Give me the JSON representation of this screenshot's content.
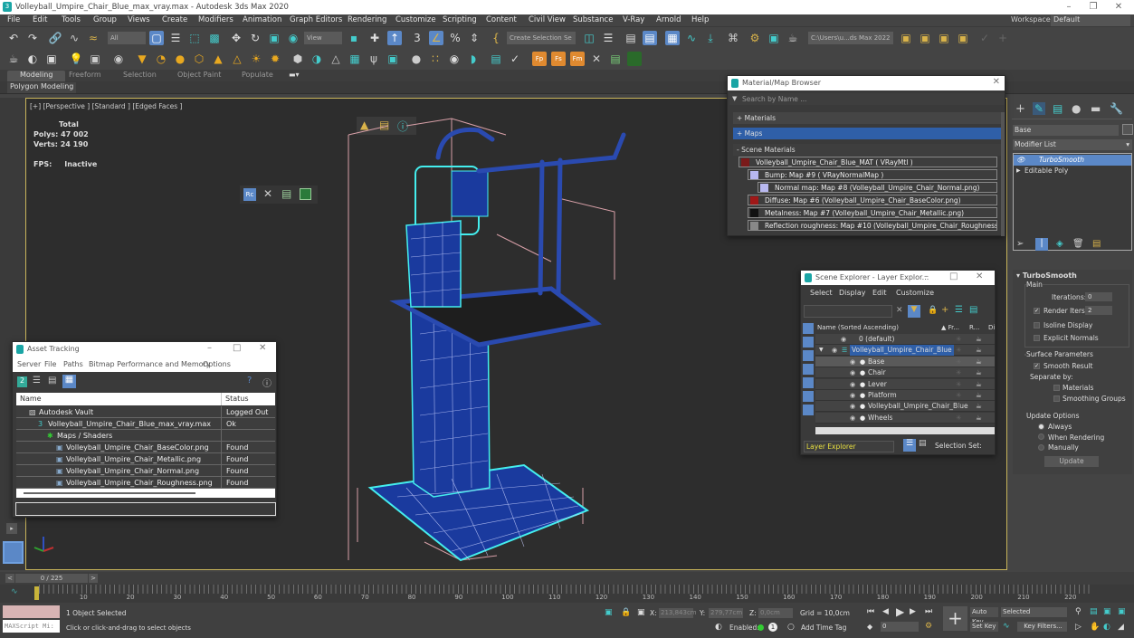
{
  "window": {
    "title": "Volleyball_Umpire_Chair_Blue_max_vray.max - Autodesk 3ds Max 2020",
    "workspaces_label": "Workspaces:",
    "workspace_value": "Default"
  },
  "menu": [
    "File",
    "Edit",
    "Tools",
    "Group",
    "Views",
    "Create",
    "Modifiers",
    "Animation",
    "Graph Editors",
    "Rendering",
    "Customize",
    "Scripting",
    "Content",
    "Civil View",
    "Substance",
    "V-Ray",
    "Arnold",
    "Help"
  ],
  "toolbar": {
    "selection_filter": "All",
    "ref_coord": "View",
    "named_selection": "Create Selection Se",
    "project_path": "C:\\Users\\u...ds Max 2022"
  },
  "ribbon": {
    "tabs": [
      "Modeling",
      "Freeform",
      "Selection",
      "Object Paint",
      "Populate"
    ],
    "active_tab": "Modeling",
    "panel": "Polygon Modeling"
  },
  "viewport": {
    "label": "[+] [Perspective ] [Standard ] [Edged Faces ]",
    "stats_total": "Total",
    "polys_label": "Polys:",
    "polys_value": "47 002",
    "verts_label": "Verts:",
    "verts_value": "24 190",
    "fps_label": "FPS:",
    "fps_value": "Inactive"
  },
  "material_browser": {
    "title": "Material/Map Browser",
    "search_placeholder": "Search by Name ...",
    "sections": [
      "+ Materials",
      "+ Maps",
      "- Scene Materials"
    ],
    "tree": [
      {
        "label": "Volleyball_Umpire_Chair_Blue_MAT ( VRayMtl )",
        "swatch": "#7a1a1a"
      },
      {
        "label": "Bump: Map #9  ( VRayNormalMap )",
        "swatch": "#b8b8f0"
      },
      {
        "label": "Normal map: Map #8 (Volleyball_Umpire_Chair_Normal.png)",
        "swatch": "#b8b8f0"
      },
      {
        "label": "Diffuse: Map #6 (Volleyball_Umpire_Chair_BaseColor.png)",
        "swatch": "#a01818"
      },
      {
        "label": "Metalness: Map #7 (Volleyball_Umpire_Chair_Metallic.png)",
        "swatch": "#111111"
      },
      {
        "label": "Reflection roughness: Map #10 (Volleyball_Umpire_Chair_Roughness.png)",
        "swatch": "#888888"
      }
    ]
  },
  "scene_explorer": {
    "title": "Scene Explorer - Layer Explor...",
    "menu": [
      "Select",
      "Display",
      "Edit",
      "Customize"
    ],
    "columns": [
      "Name (Sorted Ascending)",
      "▲ Fr...",
      "R...",
      "Di"
    ],
    "rows": [
      {
        "name": "0 (default)",
        "level": 1
      },
      {
        "name": "Volleyball_Umpire_Chair_Blue",
        "level": 0,
        "highlight": true
      },
      {
        "name": "Base",
        "level": 2,
        "selected": true
      },
      {
        "name": "Chair",
        "level": 2
      },
      {
        "name": "Lever",
        "level": 2
      },
      {
        "name": "Platform",
        "level": 2
      },
      {
        "name": "Volleyball_Umpire_Chair_Blue",
        "level": 2
      },
      {
        "name": "Wheels",
        "level": 2
      }
    ],
    "explorer_type": "Layer Explorer",
    "selection_set_label": "Selection Set:"
  },
  "asset_tracking": {
    "title": "Asset Tracking",
    "menu": [
      "Server",
      "File",
      "Paths",
      "Bitmap Performance and Memory",
      "Options"
    ],
    "columns": [
      "Name",
      "Status"
    ],
    "rows": [
      {
        "name": "Autodesk Vault",
        "status": "Logged Out ...",
        "indent": 1
      },
      {
        "name": "Volleyball_Umpire_Chair_Blue_max_vray.max",
        "status": "Ok",
        "indent": 2
      },
      {
        "name": "Maps / Shaders",
        "status": "",
        "indent": 3
      },
      {
        "name": "Volleyball_Umpire_Chair_BaseColor.png",
        "status": "Found",
        "indent": 4
      },
      {
        "name": "Volleyball_Umpire_Chair_Metallic.png",
        "status": "Found",
        "indent": 4
      },
      {
        "name": "Volleyball_Umpire_Chair_Normal.png",
        "status": "Found",
        "indent": 4
      },
      {
        "name": "Volleyball_Umpire_Chair_Roughness.png",
        "status": "Found",
        "indent": 4
      }
    ]
  },
  "command_panel": {
    "object_name": "Base",
    "modifier_list": "Modifier List",
    "stack": [
      "TurboSmooth",
      "Editable Poly"
    ],
    "rollout_title": "TurboSmooth",
    "main_label": "Main",
    "iterations_label": "Iterations:",
    "iterations_value": "0",
    "render_iters_label": "Render Iters:",
    "render_iters_value": "2",
    "render_iters_checked": true,
    "isoline_label": "Isoline Display",
    "explicit_normals_label": "Explicit Normals",
    "surface_params_label": "Surface Parameters",
    "smooth_result_label": "Smooth Result",
    "smooth_result_checked": true,
    "separate_by_label": "Separate by:",
    "materials_label": "Materials",
    "smoothing_groups_label": "Smoothing Groups",
    "update_options_label": "Update Options",
    "update_always": "Always",
    "update_when_rendering": "When Rendering",
    "update_manually": "Manually",
    "update_button": "Update"
  },
  "timeline": {
    "frame_display": "0 / 225",
    "ticks": [
      "10",
      "20",
      "30",
      "40",
      "50",
      "60",
      "70",
      "80",
      "90",
      "100",
      "110",
      "120",
      "130",
      "140",
      "150",
      "160",
      "170",
      "180",
      "190",
      "200",
      "210",
      "220"
    ]
  },
  "status": {
    "selection": "1 Object Selected",
    "prompt": "Click or click-and-drag to select objects",
    "maxscript": "MAXScript Mi:",
    "x_label": "X:",
    "x_value": "213,843cm",
    "y_label": "Y:",
    "y_value": "279,77cm",
    "z_label": "Z:",
    "z_value": "0,0cm",
    "grid": "Grid = 10,0cm",
    "enabled_label": "Enabled:",
    "add_time_tag": "Add Time Tag",
    "auto_key": "Auto Key",
    "set_key": "Set Key",
    "key_mode": "Selected",
    "key_filters": "Key Filters...",
    "current_frame": "0"
  }
}
